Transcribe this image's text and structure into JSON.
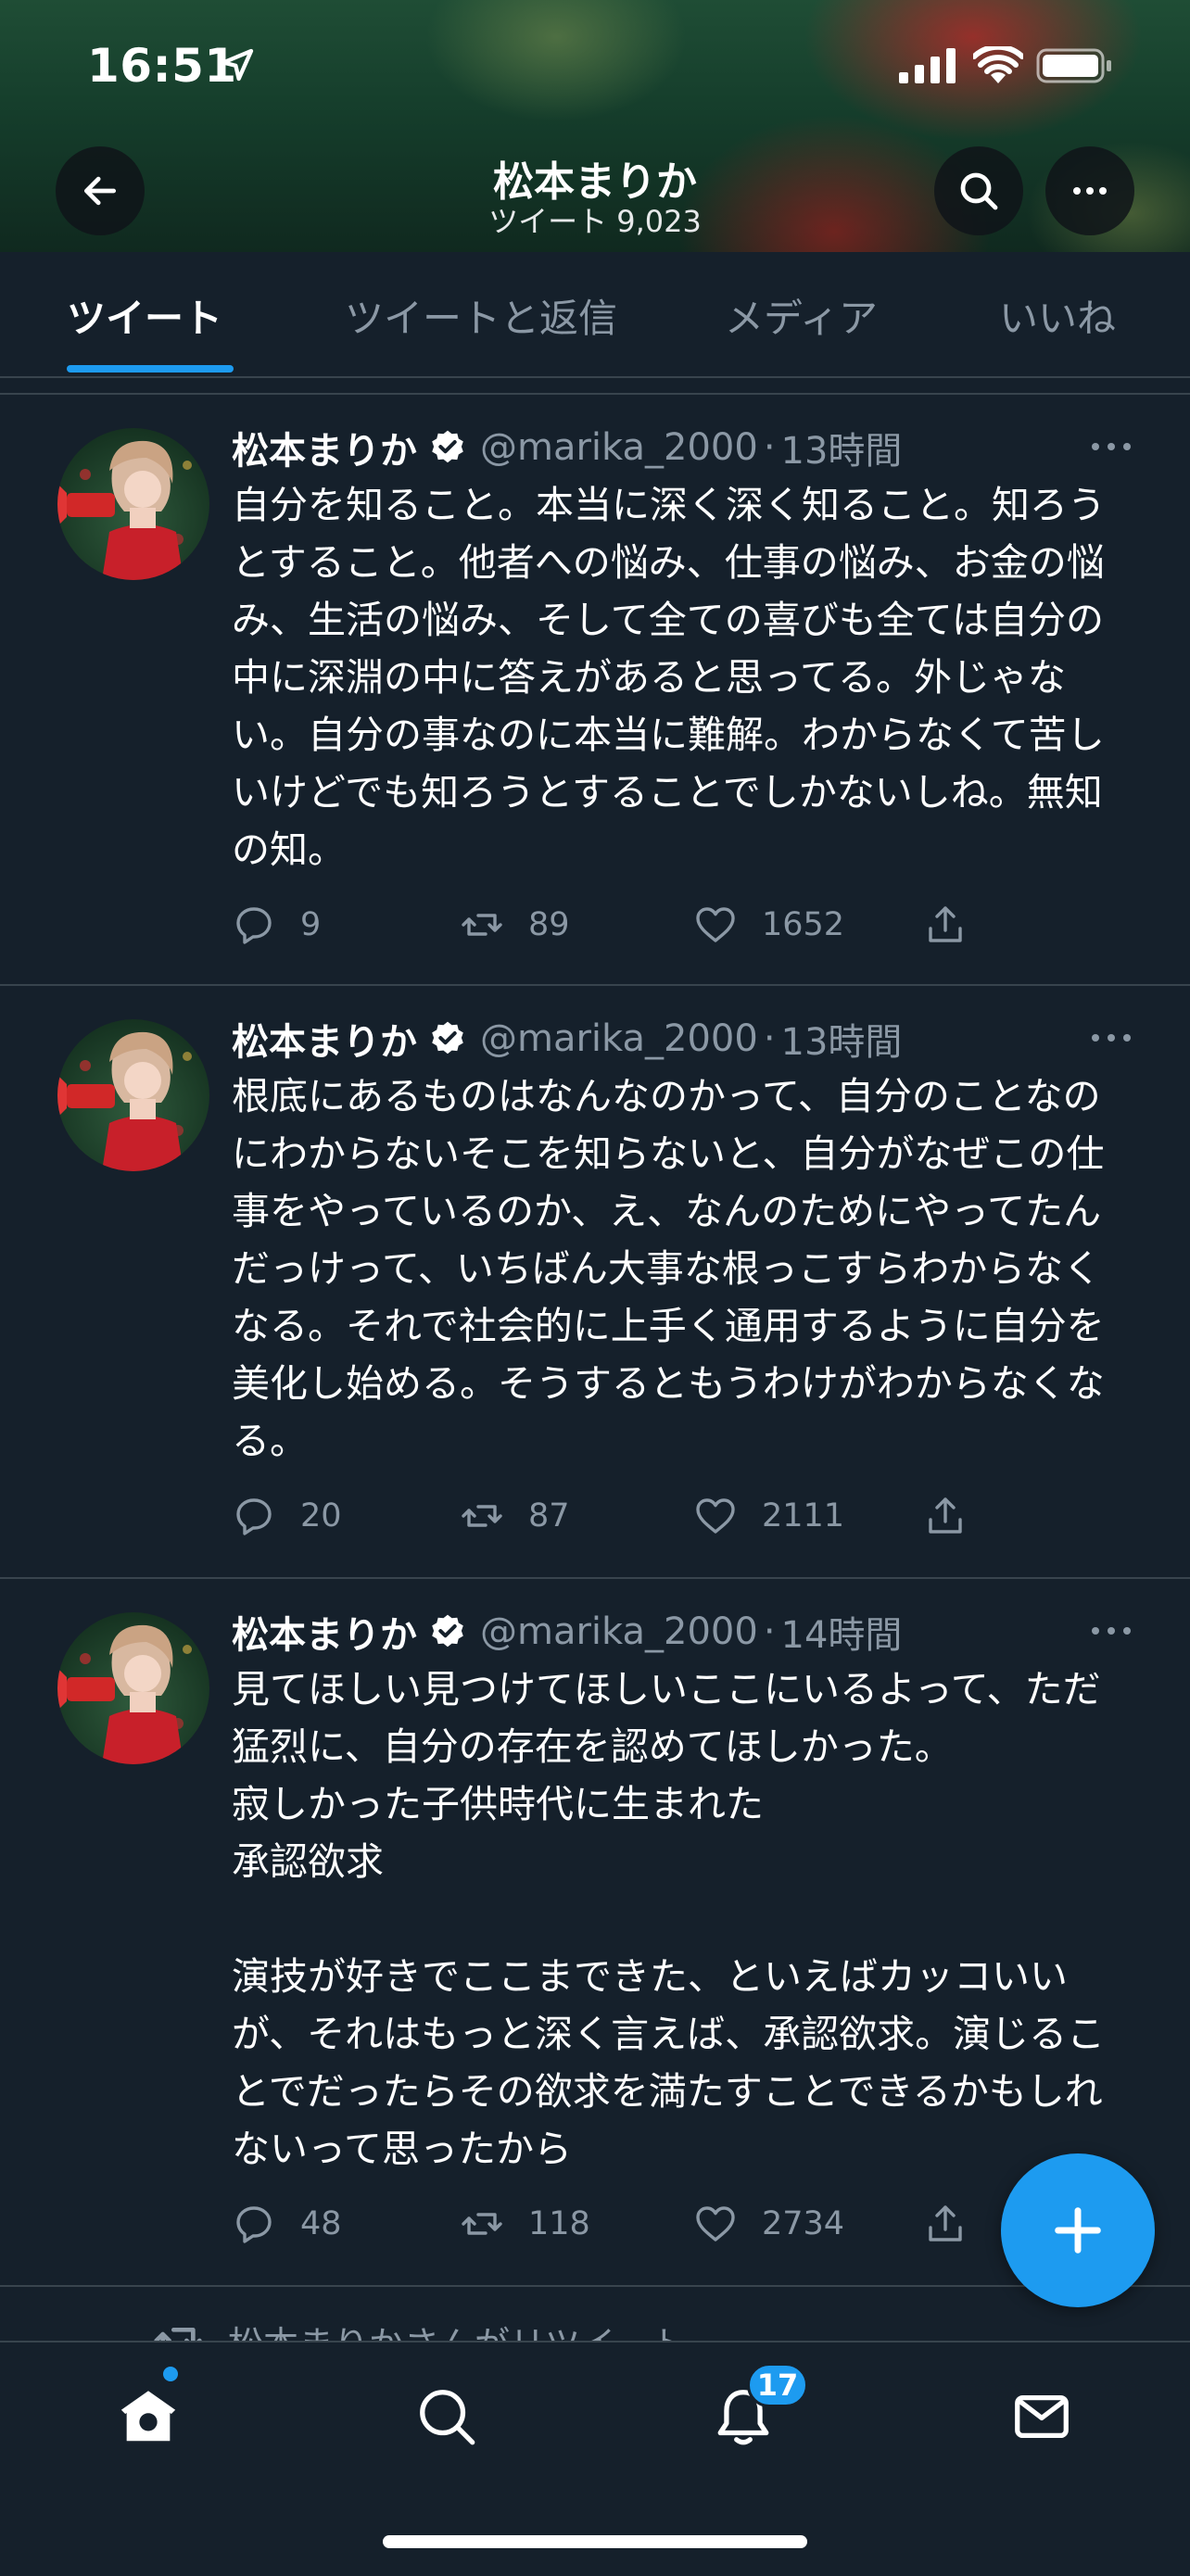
{
  "status_bar": {
    "time": "16:51"
  },
  "header": {
    "name": "松本まりか",
    "tweet_count": "ツイート 9,023"
  },
  "tabs": [
    {
      "label": "ツイート",
      "active": true
    },
    {
      "label": "ツイートと返信",
      "active": false
    },
    {
      "label": "メディア",
      "active": false
    },
    {
      "label": "いいね",
      "active": false
    }
  ],
  "tweets": [
    {
      "name": "松本まりか",
      "handle": "@marika_2000",
      "time": "13時間",
      "text": "自分を知ること。本当に深く深く知ること。知ろうとすること。他者への悩み、仕事の悩み、お金の悩み、生活の悩み、そして全ての喜びも全ては自分の中に深淵の中に答えがあると思ってる。外じゃない。自分の事なのに本当に難解。わからなくて苦しいけどでも知ろうとすることでしかないしね。無知の知。",
      "replies": "9",
      "retweets": "89",
      "likes": "1652"
    },
    {
      "name": "松本まりか",
      "handle": "@marika_2000",
      "time": "13時間",
      "text": "根底にあるものはなんなのかって、自分のことなのにわからないそこを知らないと、自分がなぜこの仕事をやっているのか、え、なんのためにやってたんだっけって、いちばん大事な根っこすらわからなくなる。それで社会的に上手く通用するように自分を美化し始める。そうするともうわけがわからなくなる。",
      "replies": "20",
      "retweets": "87",
      "likes": "2111"
    },
    {
      "name": "松本まりか",
      "handle": "@marika_2000",
      "time": "14時間",
      "text": "見てほしい見つけてほしいここにいるよって、ただ猛烈に、自分の存在を認めてほしかった。\n寂しかった子供時代に生まれた\n承認欲求\n\n演技が好きでここまできた、といえばカッコいいが、それはもっと深く言えば、承認欲求。演じることでだったらその欲求を満たすことできるかもしれないって思ったから",
      "replies": "48",
      "retweets": "118",
      "likes": "2734"
    }
  ],
  "retweet_note": "松本まりかさんがリツイート",
  "bottom_nav": {
    "notifications_badge": "17"
  },
  "colors": {
    "background": "#15202b",
    "accent": "#1d9bf0",
    "muted": "#8b98a5",
    "divider": "#38444d"
  },
  "icons": [
    "back-arrow-icon",
    "search-icon",
    "more-icon",
    "verified-badge-icon",
    "reply-icon",
    "retweet-icon",
    "like-icon",
    "share-icon",
    "compose-plus-icon",
    "home-icon",
    "notifications-icon",
    "messages-icon"
  ]
}
